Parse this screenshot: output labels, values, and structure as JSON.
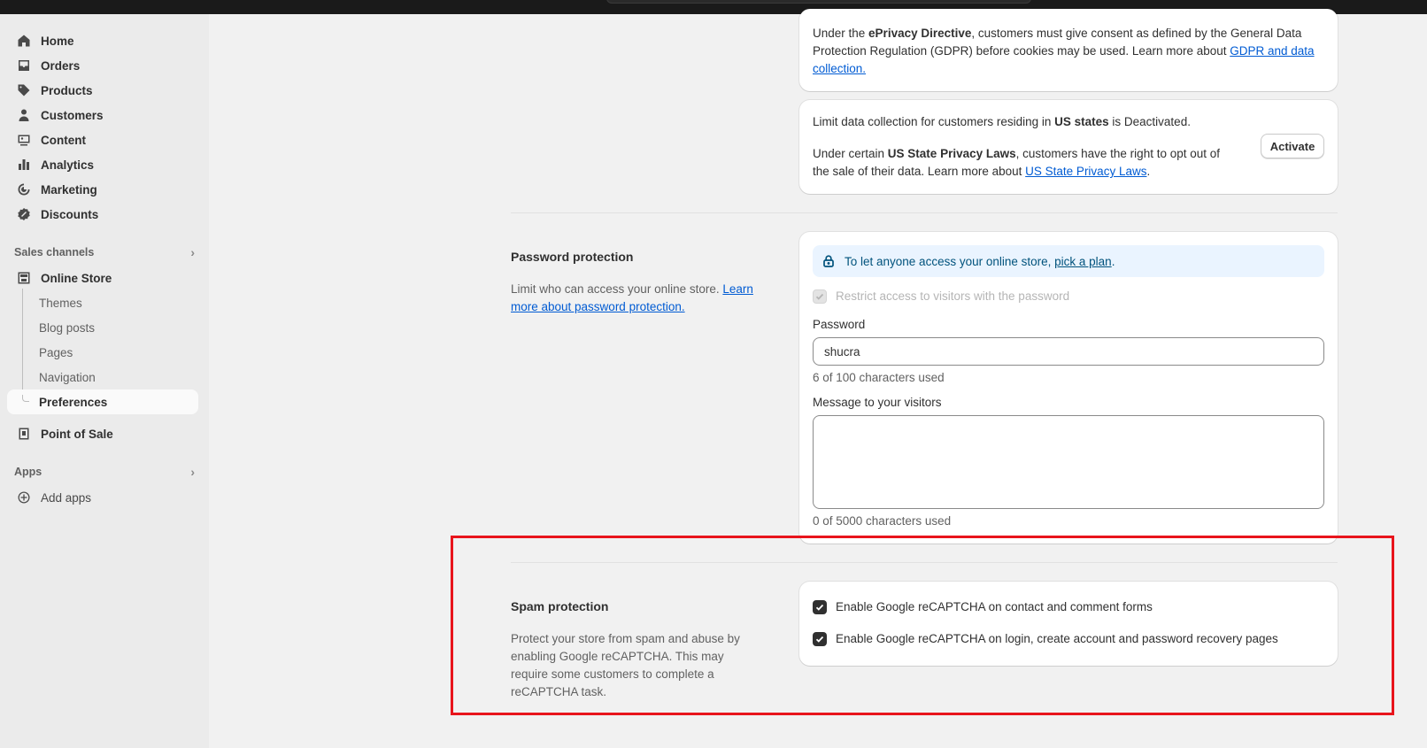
{
  "sidebar": {
    "items": [
      {
        "label": "Home",
        "icon": "home-icon"
      },
      {
        "label": "Orders",
        "icon": "inbox-icon"
      },
      {
        "label": "Products",
        "icon": "tag-icon"
      },
      {
        "label": "Customers",
        "icon": "person-icon"
      },
      {
        "label": "Content",
        "icon": "image-icon"
      },
      {
        "label": "Analytics",
        "icon": "bar-chart-icon"
      },
      {
        "label": "Marketing",
        "icon": "target-icon"
      },
      {
        "label": "Discounts",
        "icon": "discount-icon"
      }
    ],
    "sales_channels_label": "Sales channels",
    "online_store_label": "Online Store",
    "online_store_sub": [
      "Themes",
      "Blog posts",
      "Pages",
      "Navigation",
      "Preferences"
    ],
    "point_of_sale_label": "Point of Sale",
    "apps_label": "Apps",
    "add_apps_label": "Add apps"
  },
  "gdpr_card": {
    "line1_a": "Under the ",
    "line1_bold": "ePrivacy Directive",
    "line1_b": ", customers must give consent as defined by the General Data",
    "line2": "Protection Regulation (GDPR) before cookies may be used. Learn more about ",
    "link_a": "GDPR and data",
    "link_b": "collection."
  },
  "us_card": {
    "status_a": "Limit data collection for customers residing in ",
    "status_bold": "US states",
    "status_b": " is Deactivated.",
    "body_a": "Under certain ",
    "body_bold": "US State Privacy Laws",
    "body_b": ", customers have the right to opt out of",
    "body_c": "the sale of their data. Learn more about ",
    "body_link": "US State Privacy Laws",
    "body_end": ".",
    "activate_label": "Activate"
  },
  "password_section": {
    "title": "Password protection",
    "desc_a": "Limit who can access your online store. ",
    "desc_link_a": "Learn",
    "desc_link_b": "more about password protection.",
    "banner_text": "To let anyone access your online store, ",
    "banner_link": "pick a plan",
    "banner_end": ".",
    "restrict_label": "Restrict access to visitors with the password",
    "password_label": "Password",
    "password_value": "shucra",
    "password_count": "6 of 100 characters used",
    "message_label": "Message to your visitors",
    "message_value": "",
    "message_count": "0 of 5000 characters used"
  },
  "spam_section": {
    "title": "Spam protection",
    "desc_lines": [
      "Protect your store from spam and abuse by",
      "enabling Google reCAPTCHA. This may",
      "require some customers to complete a",
      "reCAPTCHA task."
    ],
    "option1": "Enable Google reCAPTCHA on contact and comment forms",
    "option2": "Enable Google reCAPTCHA on login, create account and password recovery pages"
  },
  "colors": {
    "accent_link": "#005bd3",
    "highlight_box": "#e8141c",
    "sidebar_bg": "#ebebeb",
    "main_bg": "#f1f1f1"
  }
}
